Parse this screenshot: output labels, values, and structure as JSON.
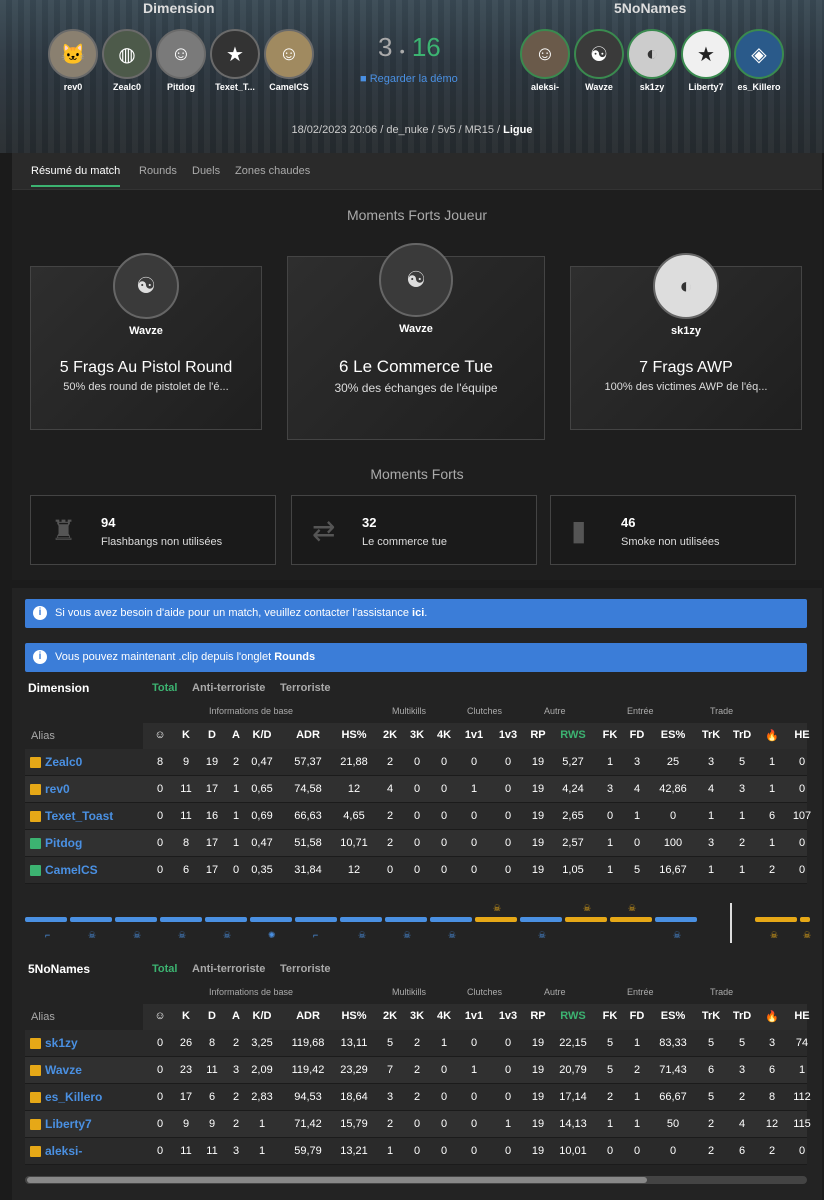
{
  "header": {
    "team1_name": "Dimension",
    "team2_name": "5NoNames",
    "score_left": "3",
    "score_sep": "•",
    "score_right": "16",
    "watch_label": "Regarder la démo",
    "match_meta": "18/02/2023 20:06 / de_nuke / 5v5 / MR15 / ",
    "match_type": "Ligue",
    "team1_players": [
      "rev0",
      "Zealc0",
      "Pitdog",
      "Texet_T...",
      "CamelCS"
    ],
    "team2_players": [
      "aleksi-",
      "Wavze",
      "sk1zy",
      "Liberty7",
      "es_Killero"
    ]
  },
  "tabs": [
    "Résumé du match",
    "Rounds",
    "Duels",
    "Zones chaudes"
  ],
  "player_highlights": {
    "title": "Moments Forts Joueur",
    "cards": [
      {
        "player": "Wavze",
        "headline": "5 Frags Au Pistol Round",
        "detail": "50% des round de pistolet de l'é..."
      },
      {
        "player": "Wavze",
        "headline": "6 Le Commerce Tue",
        "detail": "30% des échanges de l'équipe"
      },
      {
        "player": "sk1zy",
        "headline": "7 Frags AWP",
        "detail": "100% des victimes AWP de l'éq..."
      }
    ]
  },
  "highlights": {
    "title": "Moments Forts",
    "cards": [
      {
        "value": "94",
        "label": "Flashbangs non utilisées",
        "icon": "flashbang-icon"
      },
      {
        "value": "32",
        "label": "Le commerce tue",
        "icon": "trade-icon"
      },
      {
        "value": "46",
        "label": "Smoke non utilisées",
        "icon": "smoke-icon"
      }
    ]
  },
  "notices": {
    "help_text": "Si vous avez besoin d'aide pour un match, veuillez contacter l'assistance",
    "help_link": "ici",
    "help_end": ".",
    "clip_text": "Vous pouvez maintenant .clip depuis l'onglet",
    "clip_link": "Rounds"
  },
  "table": {
    "subtabs": [
      "Total",
      "Anti-terroriste",
      "Terroriste"
    ],
    "groups": [
      "Informations de base",
      "Multikills",
      "Clutches",
      "Autre",
      "Entrée",
      "Trade"
    ],
    "alias_label": "Alias",
    "columns": [
      "☺",
      "K",
      "D",
      "A",
      "K/D",
      "ADR",
      "HS%",
      "2K",
      "3K",
      "4K",
      "1v1",
      "1v3",
      "RP",
      "RWS",
      "FK",
      "FD",
      "ES%",
      "TrK",
      "TrD",
      "🔥",
      "HE"
    ]
  },
  "team1_rows": [
    {
      "name": "Zealc0",
      "side": "t",
      "v": [
        "8",
        "9",
        "19",
        "2",
        "0,47",
        "57,37",
        "21,88",
        "2",
        "0",
        "0",
        "0",
        "0",
        "19",
        "5,27",
        "1",
        "3",
        "25",
        "3",
        "5",
        "1",
        "0"
      ]
    },
    {
      "name": "rev0",
      "side": "t",
      "v": [
        "0",
        "11",
        "17",
        "1",
        "0,65",
        "74,58",
        "12",
        "4",
        "0",
        "0",
        "1",
        "0",
        "19",
        "4,24",
        "3",
        "4",
        "42,86",
        "4",
        "3",
        "1",
        "0"
      ]
    },
    {
      "name": "Texet_Toast",
      "side": "t",
      "v": [
        "0",
        "11",
        "16",
        "1",
        "0,69",
        "66,63",
        "4,65",
        "2",
        "0",
        "0",
        "0",
        "0",
        "19",
        "2,65",
        "0",
        "1",
        "0",
        "1",
        "1",
        "6",
        "107"
      ]
    },
    {
      "name": "Pitdog",
      "side": "ct",
      "v": [
        "0",
        "8",
        "17",
        "1",
        "0,47",
        "51,58",
        "10,71",
        "2",
        "0",
        "0",
        "0",
        "0",
        "19",
        "2,57",
        "1",
        "0",
        "100",
        "3",
        "2",
        "1",
        "0"
      ]
    },
    {
      "name": "CamelCS",
      "side": "ct",
      "v": [
        "0",
        "6",
        "17",
        "0",
        "0,35",
        "31,84",
        "12",
        "0",
        "0",
        "0",
        "0",
        "0",
        "19",
        "1,05",
        "1",
        "5",
        "16,67",
        "1",
        "1",
        "2",
        "0"
      ]
    }
  ],
  "team2_rows": [
    {
      "name": "sk1zy",
      "side": "t",
      "v": [
        "0",
        "26",
        "8",
        "2",
        "3,25",
        "119,68",
        "13,11",
        "5",
        "2",
        "1",
        "0",
        "0",
        "19",
        "22,15",
        "5",
        "1",
        "83,33",
        "5",
        "5",
        "3",
        "74"
      ]
    },
    {
      "name": "Wavze",
      "side": "t",
      "v": [
        "0",
        "23",
        "11",
        "3",
        "2,09",
        "119,42",
        "23,29",
        "7",
        "2",
        "0",
        "1",
        "0",
        "19",
        "20,79",
        "5",
        "2",
        "71,43",
        "6",
        "3",
        "6",
        "1"
      ]
    },
    {
      "name": "es_Killero",
      "side": "t",
      "v": [
        "0",
        "17",
        "6",
        "2",
        "2,83",
        "94,53",
        "18,64",
        "3",
        "2",
        "0",
        "0",
        "0",
        "19",
        "17,14",
        "2",
        "1",
        "66,67",
        "5",
        "2",
        "8",
        "112"
      ]
    },
    {
      "name": "Liberty7",
      "side": "t",
      "v": [
        "0",
        "9",
        "9",
        "2",
        "1",
        "71,42",
        "15,79",
        "2",
        "0",
        "0",
        "0",
        "1",
        "19",
        "14,13",
        "1",
        "1",
        "50",
        "2",
        "4",
        "12",
        "115"
      ]
    },
    {
      "name": "aleksi-",
      "side": "t",
      "v": [
        "0",
        "11",
        "11",
        "3",
        "1",
        "59,79",
        "13,21",
        "1",
        "0",
        "0",
        "0",
        "0",
        "19",
        "10,01",
        "0",
        "0",
        "0",
        "2",
        "6",
        "2",
        "0"
      ]
    }
  ]
}
